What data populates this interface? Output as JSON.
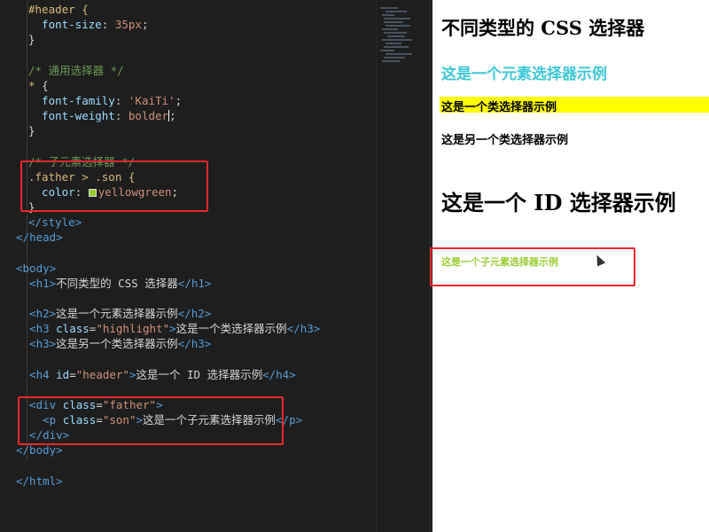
{
  "editor": {
    "lines": [
      [
        {
          "t": "#header {",
          "c": "selector"
        }
      ],
      [
        {
          "t": "  font-size",
          "c": "prop"
        },
        {
          "t": ": ",
          "c": "punc"
        },
        {
          "t": "35px",
          "c": "val"
        },
        {
          "t": ";",
          "c": "punc"
        }
      ],
      [
        {
          "t": "}",
          "c": "punc"
        }
      ],
      [],
      [
        {
          "t": "/* 通用选择器 */",
          "c": "cmt"
        }
      ],
      [
        {
          "t": "* ",
          "c": "selector"
        },
        {
          "t": "{",
          "c": "punc"
        }
      ],
      [
        {
          "t": "  font-family",
          "c": "prop"
        },
        {
          "t": ": ",
          "c": "punc"
        },
        {
          "t": "'KaiTi'",
          "c": "val"
        },
        {
          "t": ";",
          "c": "punc"
        }
      ],
      [
        {
          "t": "  font-weight",
          "c": "prop"
        },
        {
          "t": ": ",
          "c": "punc"
        },
        {
          "t": "bolder",
          "c": "val"
        },
        {
          "t": ";",
          "c": "punc"
        }
      ],
      [
        {
          "t": "}",
          "c": "punc"
        }
      ],
      [],
      [
        {
          "t": "/* 子元素选择器 */",
          "c": "cmt"
        }
      ],
      [
        {
          "t": ".father > .son {",
          "c": "selector"
        }
      ],
      [
        {
          "t": "  color",
          "c": "prop"
        },
        {
          "t": ": ",
          "c": "punc"
        },
        {
          "t": "yellowgreen",
          "c": "val"
        },
        {
          "t": ";",
          "c": "punc"
        }
      ],
      [
        {
          "t": "}",
          "c": "punc"
        }
      ],
      [
        {
          "t": "</",
          "c": "tag"
        },
        {
          "t": "style",
          "c": "tag"
        },
        {
          "t": ">",
          "c": "tag"
        }
      ],
      [
        {
          "t": "</",
          "c": "tag"
        },
        {
          "t": "head",
          "c": "tag"
        },
        {
          "t": ">",
          "c": "tag"
        }
      ],
      [],
      [
        {
          "t": "<body>",
          "c": "tag"
        }
      ],
      [
        {
          "t": "  <h1>",
          "c": "tag"
        },
        {
          "t": "不同类型的 CSS 选择器",
          "c": "txt"
        },
        {
          "t": "</h1>",
          "c": "tag"
        }
      ],
      [],
      [
        {
          "t": "  <h2>",
          "c": "tag"
        },
        {
          "t": "这是一个元素选择器示例",
          "c": "txt"
        },
        {
          "t": "</h2>",
          "c": "tag"
        }
      ],
      [
        {
          "t": "  <h3 ",
          "c": "tag"
        },
        {
          "t": "class",
          "c": "attr"
        },
        {
          "t": "=",
          "c": "punc"
        },
        {
          "t": "\"highlight\"",
          "c": "str"
        },
        {
          "t": ">",
          "c": "tag"
        },
        {
          "t": "这是一个类选择器示例",
          "c": "txt"
        },
        {
          "t": "</h3>",
          "c": "tag"
        }
      ],
      [
        {
          "t": "  <h3>",
          "c": "tag"
        },
        {
          "t": "这是另一个类选择器示例",
          "c": "txt"
        },
        {
          "t": "</h3>",
          "c": "tag"
        }
      ],
      [],
      [
        {
          "t": "  <h4 ",
          "c": "tag"
        },
        {
          "t": "id",
          "c": "attr"
        },
        {
          "t": "=",
          "c": "punc"
        },
        {
          "t": "\"header\"",
          "c": "str"
        },
        {
          "t": ">",
          "c": "tag"
        },
        {
          "t": "这是一个 ID 选择器示例",
          "c": "txt"
        },
        {
          "t": "</h4>",
          "c": "tag"
        }
      ],
      [],
      [
        {
          "t": "  <div ",
          "c": "tag"
        },
        {
          "t": "class",
          "c": "attr"
        },
        {
          "t": "=",
          "c": "punc"
        },
        {
          "t": "\"father\"",
          "c": "str"
        },
        {
          "t": ">",
          "c": "tag"
        }
      ],
      [
        {
          "t": "    <p ",
          "c": "tag"
        },
        {
          "t": "class",
          "c": "attr"
        },
        {
          "t": "=",
          "c": "punc"
        },
        {
          "t": "\"son\"",
          "c": "str"
        },
        {
          "t": ">",
          "c": "tag"
        },
        {
          "t": "这是一个子元素选择器示例",
          "c": "txt"
        },
        {
          "t": "</p>",
          "c": "tag"
        }
      ],
      [
        {
          "t": "  </div>",
          "c": "tag"
        }
      ],
      [
        {
          "t": "</body>",
          "c": "tag"
        }
      ],
      [],
      [
        {
          "t": "</html>",
          "c": "tag"
        }
      ]
    ]
  },
  "preview": {
    "h1": "不同类型的 CSS 选择器",
    "h2": "这是一个元素选择器示例",
    "h3_highlight": "这是一个类选择器示例",
    "h3_plain": "这是另一个类选择器示例",
    "h4": "这是一个 ID 选择器示例",
    "p_son": "这是一个子元素选择器示例"
  },
  "colors": {
    "h2": "#3ec7d6",
    "highlight_bg": "#ffff00",
    "son_text": "#9acd32",
    "annotation": "#e8262c",
    "editor_bg": "#1e1e1e"
  },
  "icons": [
    "color-swatch-icon",
    "mouse-pointer-icon"
  ]
}
